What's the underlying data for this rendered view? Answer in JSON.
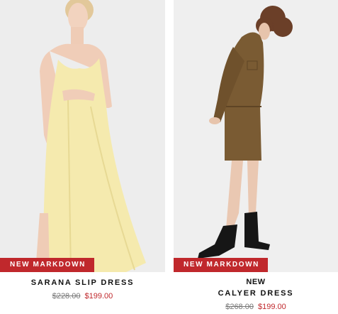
{
  "products": [
    {
      "badge": "NEW MARKDOWN",
      "new_tag": "",
      "name": "SARANA SLIP DRESS",
      "original_price": "$228.00",
      "sale_price": "$199.00"
    },
    {
      "badge": "NEW MARKDOWN",
      "new_tag": "NEW",
      "name": "CALYER DRESS",
      "original_price": "$268.00",
      "sale_price": "$199.00"
    }
  ],
  "colors": {
    "badge_bg": "#c0282c",
    "sale_price": "#c0282c",
    "photo_bg": "#ededed"
  }
}
